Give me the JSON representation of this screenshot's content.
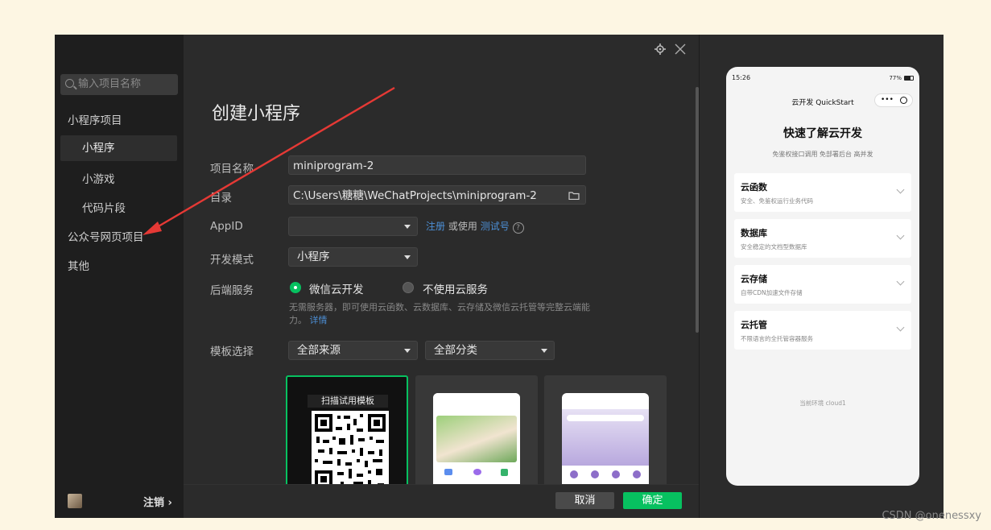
{
  "sidebar": {
    "search_placeholder": "输入项目名称",
    "sections": [
      {
        "label": "小程序项目"
      },
      {
        "label": "小程序"
      },
      {
        "label": "小游戏"
      },
      {
        "label": "代码片段"
      },
      {
        "label": "公众号网页项目"
      },
      {
        "label": "其他"
      }
    ],
    "logout": "注销 ›"
  },
  "main": {
    "title": "创建小程序",
    "fields": {
      "name_label": "项目名称",
      "name_value": "miniprogram-2",
      "dir_label": "目录",
      "dir_value": "C:\\Users\\糖糖\\WeChatProjects\\miniprogram-2",
      "appid_label": "AppID",
      "appid_value": "",
      "register": "注册",
      "or_use": "或使用",
      "test_id": "测试号",
      "mode_label": "开发模式",
      "mode_value": "小程序",
      "backend_label": "后端服务",
      "backend_option1": "微信云开发",
      "backend_option2": "不使用云服务",
      "backend_desc": "无需服务器，即可使用云函数、云数据库、云存储及微信云托管等完整云端能",
      "backend_desc2": "力。",
      "details": "详情",
      "template_label": "模板选择",
      "source_value": "全部来源",
      "category_value": "全部分类",
      "qr_title": "扫描试用模板"
    },
    "buttons": {
      "cancel": "取消",
      "confirm": "确定"
    }
  },
  "preview": {
    "time": "15:26",
    "battery": "77%",
    "nav_title": "云开发 QuickStart",
    "heading": "快速了解云开发",
    "subheading": "免鉴权接口调用 免部署后台 高并发",
    "items": [
      {
        "title": "云函数",
        "desc": "安全、免鉴权运行业务代码"
      },
      {
        "title": "数据库",
        "desc": "安全稳定的文档型数据库"
      },
      {
        "title": "云存储",
        "desc": "自带CDN加速文件存储"
      },
      {
        "title": "云托管",
        "desc": "不限语言的全托管容器服务"
      }
    ],
    "env": "当前环境 cloud1"
  },
  "watermark": "CSDN @onenessxy",
  "colors": {
    "accent": "#07c160",
    "link": "#4c8fd6",
    "arrow": "#e53935"
  }
}
